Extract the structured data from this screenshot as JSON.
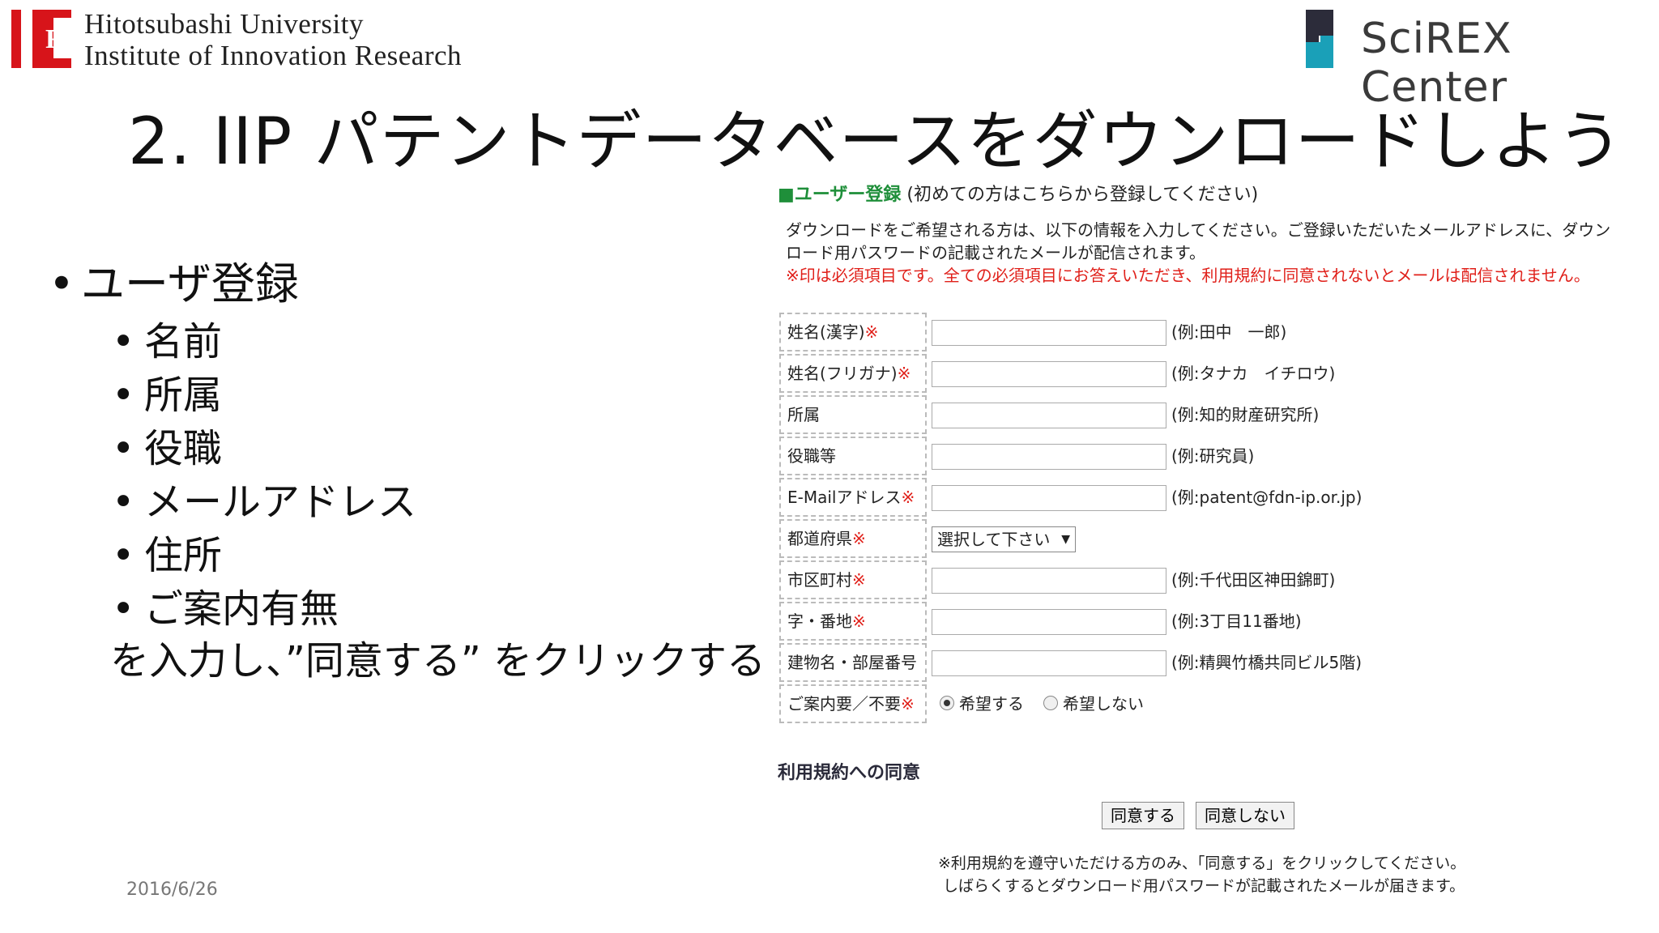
{
  "header": {
    "iir_logo_letter": "R",
    "org_line1": "Hitotsubashi University",
    "org_line2": "Institute of Innovation Research",
    "partner_name": "SciREX Center"
  },
  "slide": {
    "title": "2. IIP パテントデータベースをダウンロードしよう",
    "bullet_main": "ユーザ登録",
    "sub_bullets": [
      "名前",
      "所属",
      "役職",
      "メールアドレス",
      "住所",
      "ご案内有無"
    ],
    "tail_text": "を入力し、”同意する” をクリックする",
    "date": "2016/6/26",
    "bullet_glyph": "•"
  },
  "form": {
    "title_square": "■",
    "title": "ユーザー登録",
    "title_note": "(初めての方はこちらから登録してください)",
    "intro": "ダウンロードをご希望される方は、以下の情報を入力してください。ご登録いただいたメールアドレスに、ダウンロード用パスワードの記載されたメールが配信されます。",
    "required_note": "※印は必須項目です。全ての必須項目にお答えいただき、利用規約に同意されないとメールは配信されません。",
    "required_mark": "※",
    "fields": [
      {
        "label": "姓名(漢字)",
        "required": true,
        "value": "",
        "example": "(例:田中　一郎)"
      },
      {
        "label": "姓名(フリガナ)",
        "required": true,
        "value": "",
        "example": "(例:タナカ　イチロウ)"
      },
      {
        "label": "所属",
        "required": false,
        "value": "",
        "example": "(例:知的財産研究所)"
      },
      {
        "label": "役職等",
        "required": false,
        "value": "",
        "example": "(例:研究員)"
      },
      {
        "label": "E-Mailアドレス",
        "required": true,
        "value": "",
        "example": "(例:patent@fdn-ip.or.jp)"
      },
      {
        "label": "都道府県",
        "required": true,
        "select_value": "選択して下さい"
      },
      {
        "label": "市区町村",
        "required": true,
        "value": "",
        "example": "(例:千代田区神田錦町)"
      },
      {
        "label": "字・番地",
        "required": true,
        "value": "",
        "example": "(例:3丁目11番地)"
      },
      {
        "label": "建物名・部屋番号",
        "required": false,
        "value": "",
        "example": "(例:精興竹橋共同ビル5階)"
      },
      {
        "label": "ご案内要／不要",
        "required": true,
        "radio_options": [
          "希望する",
          "希望しない"
        ],
        "radio_selected": 0
      }
    ],
    "agree_heading": "利用規約への同意",
    "agree_button": "同意する",
    "disagree_button": "同意しない",
    "note_line1": "※利用規約を遵守いただける方のみ、「同意する」をクリックしてください。",
    "note_line2": "しばらくするとダウンロード用パスワードが記載されたメールが届きます。",
    "select_arrow": "▼"
  },
  "colors": {
    "brand_red": "#d7141a",
    "form_green": "#1f8f3a",
    "required_red": "#e0201a",
    "scirex_teal": "#1aa0b8",
    "scirex_dark": "#2c2c3a"
  }
}
